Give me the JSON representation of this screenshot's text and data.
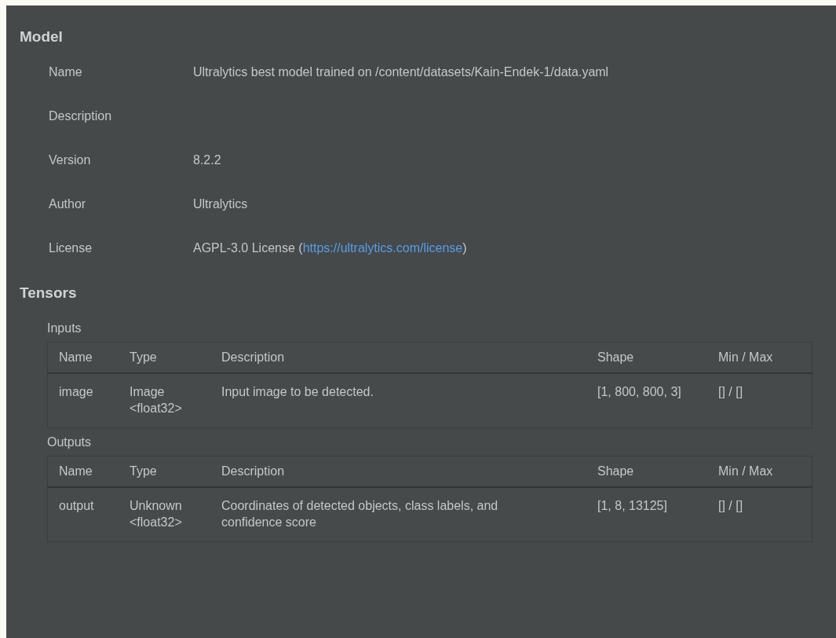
{
  "model": {
    "title": "Model",
    "properties": [
      {
        "label": "Name",
        "value": "Ultralytics best model trained on /content/datasets/Kain-Endek-1/data.yaml"
      },
      {
        "label": "Description"
      },
      {
        "label": "Version",
        "value": "8.2.2"
      },
      {
        "label": "Author",
        "value": "Ultralytics"
      },
      {
        "label": "License",
        "value": "AGPL-3.0 License (",
        "link": "https://ultralytics.com/license",
        "suffix": ")"
      }
    ]
  },
  "tensors": {
    "title": "Tensors",
    "groups": [
      {
        "title": "Inputs",
        "columns": [
          "Name",
          "Type",
          "Description",
          "Shape",
          "Min / Max"
        ],
        "rows": [
          {
            "cells": [
              "image",
              "Image\n<float32>",
              "Input image to be detected.",
              "[1, 800, 800, 3]",
              "[] / []"
            ]
          }
        ]
      },
      {
        "title": "Outputs",
        "columns": [
          "Name",
          "Type",
          "Description",
          "Shape",
          "Min / Max"
        ],
        "rows": [
          {
            "cells": [
              "output",
              "Unknown\n<float32>",
              "Coordinates of detected objects, class labels, and\nconfidence score",
              "[1, 8, 13125]",
              "[] / []"
            ]
          }
        ]
      }
    ]
  }
}
